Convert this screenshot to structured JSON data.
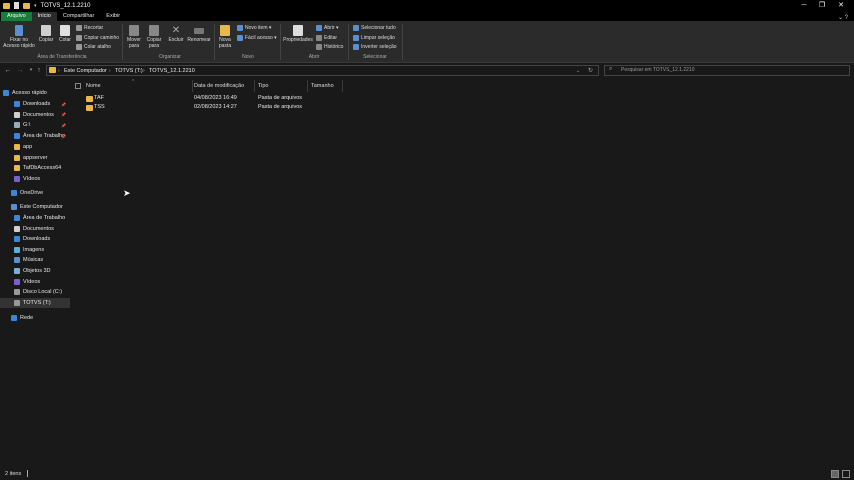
{
  "window": {
    "title": "TOTVS_12.1.2210",
    "minimize": "─",
    "maximize": "❐",
    "close": "✕"
  },
  "tabs": [
    {
      "label": "Arquivo"
    },
    {
      "label": "Início"
    },
    {
      "label": "Compartilhar"
    },
    {
      "label": "Exibir"
    }
  ],
  "ribbon": {
    "pin": "Fixar no Acesso rápido",
    "copy": "Copiar",
    "paste": "Colar",
    "cut": "Recortar",
    "copy_path": "Copiar caminho",
    "paste_shortcut": "Colar atalho",
    "group_clipboard": "Área de Transferência",
    "move_to": "Mover para",
    "copy_to": "Copiar para",
    "delete": "Excluir",
    "rename": "Renomear",
    "group_organize": "Organizar",
    "new_folder": "Nova pasta",
    "new_item": "Novo item ▾",
    "easy_access": "Fácil acesso ▾",
    "group_new": "Novo",
    "properties": "Propriedades",
    "open": "Abrir ▾",
    "edit": "Editar",
    "history": "Histórico",
    "group_open": "Abrir",
    "select_all": "Selecionar tudo",
    "select_none": "Limpar seleção",
    "invert": "Inverter seleção",
    "group_select": "Selecionar"
  },
  "address": {
    "crumbs": [
      "Este Computador",
      "TOTVS (T:)",
      "TOTVS_12.1.2210"
    ],
    "search_placeholder": "Pesquisar em TOTVS_12.1.2210"
  },
  "nav": {
    "quick": "Acesso rápido",
    "quick_items": [
      {
        "label": "Downloads"
      },
      {
        "label": "Documentos"
      },
      {
        "label": "G:\\"
      },
      {
        "label": "Área de Trabalho"
      },
      {
        "label": "app"
      },
      {
        "label": "appserver"
      },
      {
        "label": "TafDbAccess64"
      },
      {
        "label": "Vídeos"
      }
    ],
    "onedrive": "OneDrive",
    "pc": "Este Computador",
    "pc_items": [
      {
        "label": "Área de Trabalho"
      },
      {
        "label": "Documentos"
      },
      {
        "label": "Downloads"
      },
      {
        "label": "Imagens"
      },
      {
        "label": "Músicas"
      },
      {
        "label": "Objetos 3D"
      },
      {
        "label": "Vídeos"
      },
      {
        "label": "Disco Local (C:)"
      },
      {
        "label": "TOTVS (T:)"
      }
    ],
    "network": "Rede"
  },
  "columns": {
    "name": "Nome",
    "date": "Data de modificação",
    "type": "Tipo",
    "size": "Tamanho"
  },
  "files": [
    {
      "name": "TAF",
      "date": "04/08/2023 16:49",
      "type": "Pasta de arquivos"
    },
    {
      "name": "TSS",
      "date": "02/08/2023 14:27",
      "type": "Pasta de arquivos"
    }
  ],
  "status": "2 itens",
  "colors": {
    "folder": "#e8b94a",
    "accent": "#1a7c3a"
  }
}
